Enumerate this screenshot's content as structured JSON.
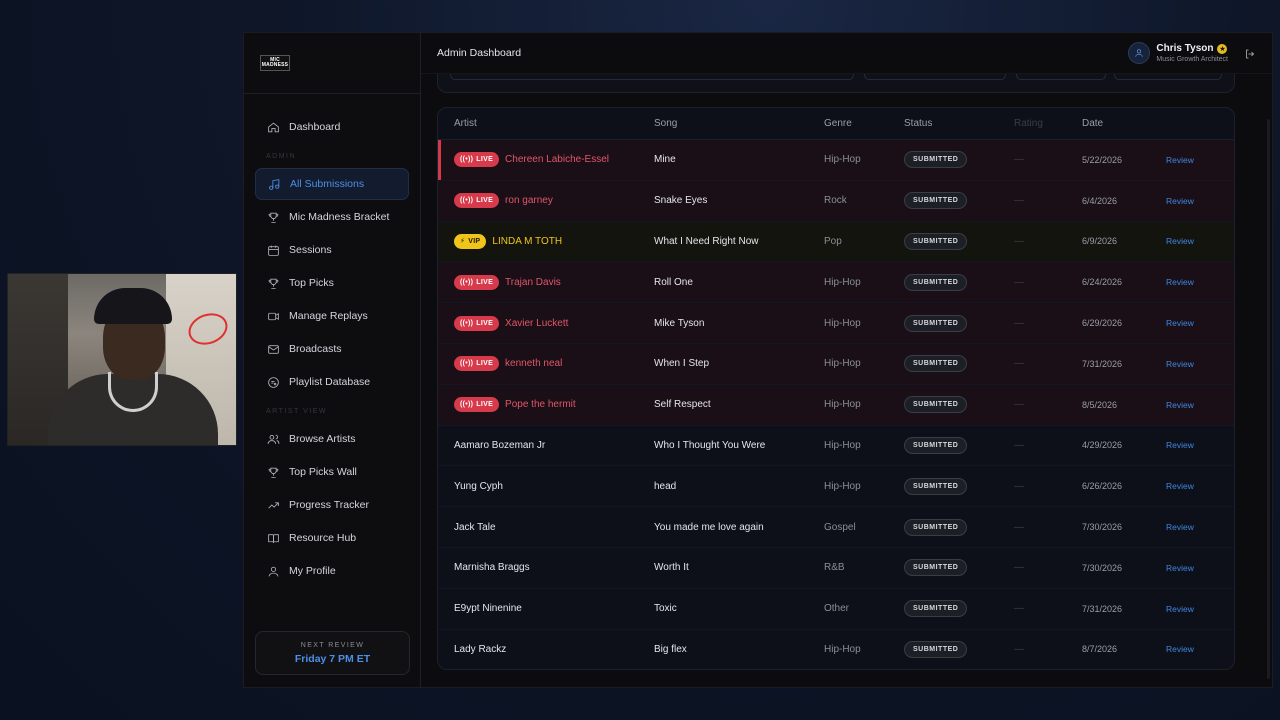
{
  "app": {
    "title": "Admin Dashboard"
  },
  "logo": {
    "line1": "MIC",
    "line2": "MADNESS"
  },
  "sidebar": {
    "items": [
      {
        "label": "Dashboard",
        "icon": "home-icon"
      },
      {
        "label": "All Submissions",
        "icon": "music-note-icon",
        "active": true
      },
      {
        "label": "Mic Madness Bracket",
        "icon": "trophy-icon"
      },
      {
        "label": "Sessions",
        "icon": "calendar-icon"
      },
      {
        "label": "Top Picks",
        "icon": "trophy-icon"
      },
      {
        "label": "Manage Replays",
        "icon": "video-icon"
      },
      {
        "label": "Broadcasts",
        "icon": "mail-icon"
      },
      {
        "label": "Playlist Database",
        "icon": "playlist-icon"
      },
      {
        "label": "Browse Artists",
        "icon": "users-icon"
      },
      {
        "label": "Top Picks Wall",
        "icon": "trophy-icon"
      },
      {
        "label": "Progress Tracker",
        "icon": "trending-up-icon"
      },
      {
        "label": "Resource Hub",
        "icon": "book-icon"
      },
      {
        "label": "My Profile",
        "icon": "user-icon"
      }
    ],
    "section_admin": "ADMIN",
    "section_artist": "ARTIST VIEW",
    "next_review_label": "NEXT REVIEW",
    "next_review_time": "Friday 7 PM ET"
  },
  "user": {
    "name": "Chris Tyson",
    "role": "Music Growth Architect"
  },
  "table": {
    "headers": {
      "artist": "Artist",
      "song": "Song",
      "genre": "Genre",
      "status": "Status",
      "rating": "Rating",
      "date": "Date"
    },
    "rows": [
      {
        "badge": "LIVE",
        "artist": "Chereen Labiche-Essel",
        "song": "Mine",
        "genre": "Hip-Hop",
        "status": "SUBMITTED",
        "rating": "—",
        "date": "5/22/2026",
        "action": "Review"
      },
      {
        "badge": "LIVE",
        "artist": "ron garney",
        "song": "Snake Eyes",
        "genre": "Rock",
        "status": "SUBMITTED",
        "rating": "—",
        "date": "6/4/2026",
        "action": "Review"
      },
      {
        "badge": "VIP",
        "artist": "LINDA M TOTH",
        "song": "What I Need Right Now",
        "genre": "Pop",
        "status": "SUBMITTED",
        "rating": "—",
        "date": "6/9/2026",
        "action": "Review"
      },
      {
        "badge": "LIVE",
        "artist": "Trajan Davis",
        "song": "Roll One",
        "genre": "Hip-Hop",
        "status": "SUBMITTED",
        "rating": "—",
        "date": "6/24/2026",
        "action": "Review"
      },
      {
        "badge": "LIVE",
        "artist": "Xavier Luckett",
        "song": "Mike Tyson",
        "genre": "Hip-Hop",
        "status": "SUBMITTED",
        "rating": "—",
        "date": "6/29/2026",
        "action": "Review"
      },
      {
        "badge": "LIVE",
        "artist": "kenneth neal",
        "song": "When I Step",
        "genre": "Hip-Hop",
        "status": "SUBMITTED",
        "rating": "—",
        "date": "7/31/2026",
        "action": "Review"
      },
      {
        "badge": "LIVE",
        "artist": "Pope the hermit",
        "song": "Self Respect",
        "genre": "Hip-Hop",
        "status": "SUBMITTED",
        "rating": "—",
        "date": "8/5/2026",
        "action": "Review"
      },
      {
        "badge": "",
        "artist": "Aamaro Bozeman Jr",
        "song": "Who I Thought You Were",
        "genre": "Hip-Hop",
        "status": "SUBMITTED",
        "rating": "—",
        "date": "4/29/2026",
        "action": "Review"
      },
      {
        "badge": "",
        "artist": "Yung Cyph",
        "song": "head",
        "genre": "Hip-Hop",
        "status": "SUBMITTED",
        "rating": "—",
        "date": "6/26/2026",
        "action": "Review"
      },
      {
        "badge": "",
        "artist": "Jack Tale",
        "song": "You made me love again",
        "genre": "Gospel",
        "status": "SUBMITTED",
        "rating": "—",
        "date": "7/30/2026",
        "action": "Review"
      },
      {
        "badge": "",
        "artist": "Marnisha Braggs",
        "song": "Worth It",
        "genre": "R&B",
        "status": "SUBMITTED",
        "rating": "—",
        "date": "7/30/2026",
        "action": "Review"
      },
      {
        "badge": "",
        "artist": "E9ypt Ninenine",
        "song": "Toxic",
        "genre": "Other",
        "status": "SUBMITTED",
        "rating": "—",
        "date": "7/31/2026",
        "action": "Review"
      },
      {
        "badge": "",
        "artist": "Lady Rackz",
        "song": "Big flex",
        "genre": "Hip-Hop",
        "status": "SUBMITTED",
        "rating": "—",
        "date": "8/7/2026",
        "action": "Review"
      }
    ]
  },
  "colors": {
    "accent": "#4d8fe6",
    "live": "#d73a4a",
    "vip": "#f0c419",
    "background": "#0c0c0e"
  }
}
